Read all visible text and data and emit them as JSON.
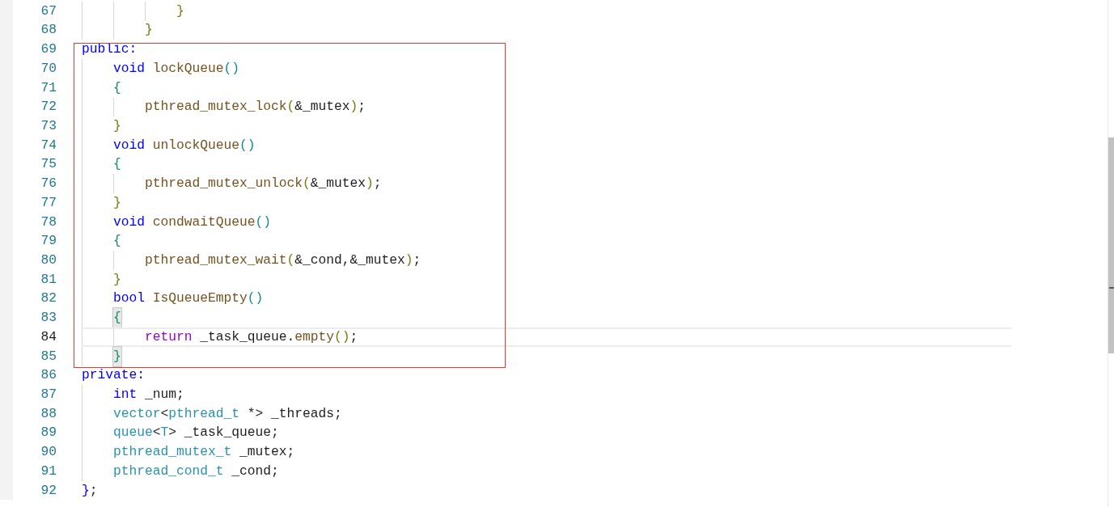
{
  "editor": {
    "lines": [
      {
        "number": "67",
        "current": false,
        "tokens": [
          {
            "text": "            }",
            "kind": "brace_close"
          }
        ]
      },
      {
        "number": "68",
        "current": false,
        "tokens": [
          {
            "text": "        }",
            "kind": "brace_close"
          }
        ]
      },
      {
        "number": "69",
        "current": false,
        "tokens": [
          {
            "text": "public:",
            "kind": "kw"
          }
        ]
      },
      {
        "number": "70",
        "current": false,
        "tokens": [
          {
            "text": "    void ",
            "kind": "kw"
          },
          {
            "text": "lockQueue",
            "kind": "fn"
          },
          {
            "text": "()",
            "kind": "paren"
          }
        ]
      },
      {
        "number": "71",
        "current": false,
        "tokens": [
          {
            "text": "    {",
            "kind": "brace_open"
          }
        ]
      },
      {
        "number": "72",
        "current": false,
        "tokens": [
          {
            "text": "        pthread_mutex_lock",
            "kind": "fn"
          },
          {
            "text": "(",
            "kind": "brace_close"
          },
          {
            "text": "&_mutex",
            "kind": "plain"
          },
          {
            "text": ")",
            "kind": "brace_close"
          },
          {
            "text": ";",
            "kind": "plain"
          }
        ]
      },
      {
        "number": "73",
        "current": false,
        "tokens": [
          {
            "text": "    }",
            "kind": "brace_close"
          }
        ]
      },
      {
        "number": "74",
        "current": false,
        "tokens": [
          {
            "text": "    void ",
            "kind": "kw"
          },
          {
            "text": "unlockQueue",
            "kind": "fn"
          },
          {
            "text": "()",
            "kind": "paren"
          }
        ]
      },
      {
        "number": "75",
        "current": false,
        "tokens": [
          {
            "text": "    {",
            "kind": "brace_open"
          }
        ]
      },
      {
        "number": "76",
        "current": false,
        "tokens": [
          {
            "text": "        pthread_mutex_unlock",
            "kind": "fn"
          },
          {
            "text": "(",
            "kind": "brace_close"
          },
          {
            "text": "&_mutex",
            "kind": "plain"
          },
          {
            "text": ")",
            "kind": "brace_close"
          },
          {
            "text": ";",
            "kind": "plain"
          }
        ]
      },
      {
        "number": "77",
        "current": false,
        "tokens": [
          {
            "text": "    }",
            "kind": "brace_close"
          }
        ]
      },
      {
        "number": "78",
        "current": false,
        "tokens": [
          {
            "text": "    void ",
            "kind": "kw"
          },
          {
            "text": "condwaitQueue",
            "kind": "fn"
          },
          {
            "text": "()",
            "kind": "paren"
          }
        ]
      },
      {
        "number": "79",
        "current": false,
        "tokens": [
          {
            "text": "    {",
            "kind": "brace_open"
          }
        ]
      },
      {
        "number": "80",
        "current": false,
        "tokens": [
          {
            "text": "        pthread_mutex_wait",
            "kind": "fn"
          },
          {
            "text": "(",
            "kind": "brace_close"
          },
          {
            "text": "&_cond,&_mutex",
            "kind": "plain"
          },
          {
            "text": ")",
            "kind": "brace_close"
          },
          {
            "text": ";",
            "kind": "plain"
          }
        ]
      },
      {
        "number": "81",
        "current": false,
        "tokens": [
          {
            "text": "    }",
            "kind": "brace_close"
          }
        ]
      },
      {
        "number": "82",
        "current": false,
        "tokens": [
          {
            "text": "    bool ",
            "kind": "kw"
          },
          {
            "text": "IsQueueEmpty",
            "kind": "fn"
          },
          {
            "text": "()",
            "kind": "paren"
          }
        ]
      },
      {
        "number": "83",
        "current": false,
        "tokens": [
          {
            "text": "    {",
            "kind": "brace_match"
          }
        ]
      },
      {
        "number": "84",
        "current": true,
        "tokens": [
          {
            "text": "        return",
            "kind": "ctrl"
          },
          {
            "text": " _task_queue.",
            "kind": "plain"
          },
          {
            "text": "empty",
            "kind": "fn"
          },
          {
            "text": "()",
            "kind": "brace_close"
          },
          {
            "text": ";",
            "kind": "plain"
          }
        ]
      },
      {
        "number": "85",
        "current": false,
        "tokens": [
          {
            "text": "    }",
            "kind": "brace_match"
          }
        ]
      },
      {
        "number": "86",
        "current": false,
        "tokens": [
          {
            "text": "private:",
            "kind": "kw"
          }
        ]
      },
      {
        "number": "87",
        "current": false,
        "tokens": [
          {
            "text": "    int",
            "kind": "kw"
          },
          {
            "text": " _num;",
            "kind": "plain"
          }
        ]
      },
      {
        "number": "88",
        "current": false,
        "tokens": [
          {
            "text": "    vector",
            "kind": "type"
          },
          {
            "text": "<",
            "kind": "plain"
          },
          {
            "text": "pthread_t",
            "kind": "type"
          },
          {
            "text": " *> _threads;",
            "kind": "plain"
          }
        ]
      },
      {
        "number": "89",
        "current": false,
        "tokens": [
          {
            "text": "    queue",
            "kind": "type"
          },
          {
            "text": "<",
            "kind": "plain"
          },
          {
            "text": "T",
            "kind": "type"
          },
          {
            "text": "> _task_queue;",
            "kind": "plain"
          }
        ]
      },
      {
        "number": "90",
        "current": false,
        "tokens": [
          {
            "text": "    pthread_mutex_t",
            "kind": "type"
          },
          {
            "text": " _mutex;",
            "kind": "plain"
          }
        ]
      },
      {
        "number": "91",
        "current": false,
        "tokens": [
          {
            "text": "    pthread_cond_t",
            "kind": "type"
          },
          {
            "text": " _cond;",
            "kind": "plain"
          }
        ]
      },
      {
        "number": "92",
        "current": false,
        "tokens": [
          {
            "text": "}",
            "kind": "kw"
          },
          {
            "text": ";",
            "kind": "plain"
          }
        ]
      }
    ]
  }
}
